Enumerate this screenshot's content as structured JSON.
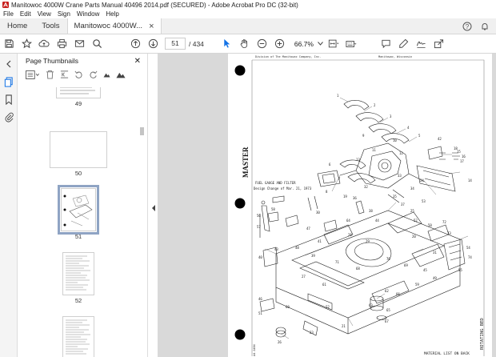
{
  "window": {
    "title": "Manitowoc 4000W Crane Parts Manual 40496 2014.pdf (SECURED) - Adobe Acrobat Pro DC (32-bit)"
  },
  "menu": [
    "File",
    "Edit",
    "View",
    "Sign",
    "Window",
    "Help"
  ],
  "tabs": {
    "home": "Home",
    "tools": "Tools",
    "document": "Manitowoc 4000W..."
  },
  "toolbar": {
    "current_page": "51",
    "page_total": "/ 434",
    "zoom": "66.7%"
  },
  "thumbnail_panel": {
    "title": "Page Thumbnails",
    "thumbnails": [
      {
        "label": "49"
      },
      {
        "label": "50"
      },
      {
        "label": "51",
        "selected": true
      },
      {
        "label": "52"
      },
      {
        "label": ""
      }
    ]
  },
  "document_page": {
    "header_left": "Division of The Manitowoc Company, Inc.",
    "header_right": "Manitowoc, Wisconsin",
    "stamp": "MASTER",
    "note_line1": "FUEL GAUGE AND FILTER",
    "note_line2": "Design Change of Mar. 21, 1973",
    "side_title": "ROTATING BED",
    "footer": "MATERIAL LIST ON BACK",
    "part_number": "A4-1484",
    "callouts": [
      "1",
      "2",
      "3",
      "4",
      "5",
      "6",
      "7",
      "8",
      "9",
      "10",
      "11",
      "12",
      "13",
      "14",
      "15",
      "16",
      "17",
      "18",
      "19",
      "20",
      "21",
      "22",
      "23",
      "24",
      "25",
      "26",
      "27",
      "28",
      "29",
      "30",
      "31",
      "32",
      "33",
      "34",
      "35",
      "36",
      "37",
      "38",
      "39",
      "40",
      "41",
      "42",
      "43",
      "44",
      "45",
      "46",
      "47",
      "48",
      "49",
      "50",
      "51",
      "52",
      "53",
      "54",
      "55",
      "56",
      "57",
      "58",
      "59",
      "60",
      "61",
      "62",
      "63",
      "64",
      "65",
      "66",
      "67",
      "68",
      "69",
      "70",
      "71",
      "72",
      "73",
      "74"
    ]
  },
  "colors": {
    "accent": "#1473e6",
    "selected_thumb": "#8fa4c4",
    "doc_bg": "#d9d9d9"
  }
}
